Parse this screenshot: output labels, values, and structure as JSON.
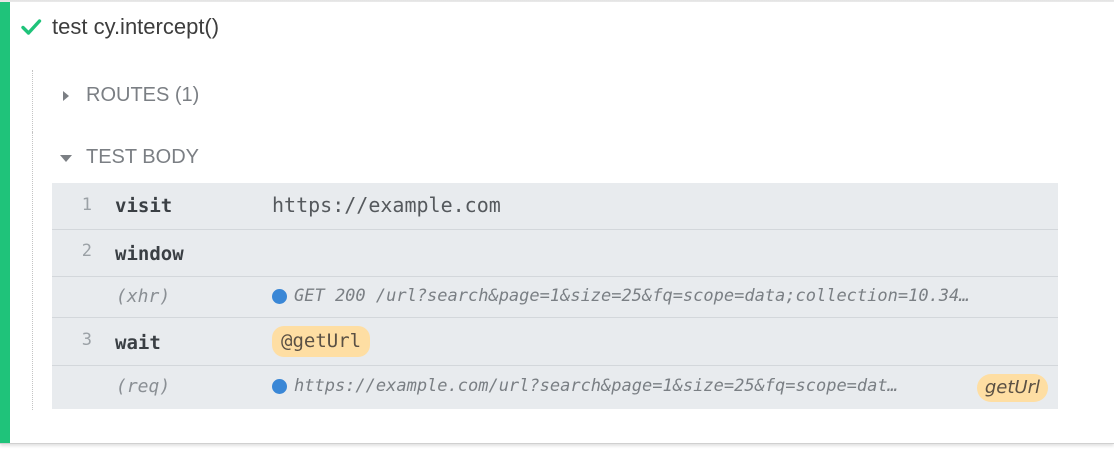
{
  "test": {
    "title": "test cy.intercept()",
    "status": "passed",
    "accent_color": "#1fc37a"
  },
  "routes": {
    "label": "ROUTES (1)",
    "expanded": false
  },
  "test_body": {
    "label": "TEST BODY",
    "expanded": true
  },
  "commands": [
    {
      "number": "1",
      "name": "visit",
      "message": "https://example.com"
    },
    {
      "number": "2",
      "name": "window",
      "message": ""
    },
    {
      "number": "",
      "name": "(xhr)",
      "message": "GET 200 /url?search&page=1&size=25&fq=scope=data;collection=10.34…",
      "dot_color": "#3a87d6"
    },
    {
      "number": "3",
      "name": "wait",
      "message": "@getUrl"
    },
    {
      "number": "",
      "name": "(req)",
      "message": "https://example.com/url?search&page=1&size=25&fq=scope=dat…",
      "alias": "getUrl",
      "dot_color": "#3a87d6"
    }
  ],
  "colors": {
    "alias_bg": "#fedea3",
    "command_bg": "#e8ebee"
  }
}
